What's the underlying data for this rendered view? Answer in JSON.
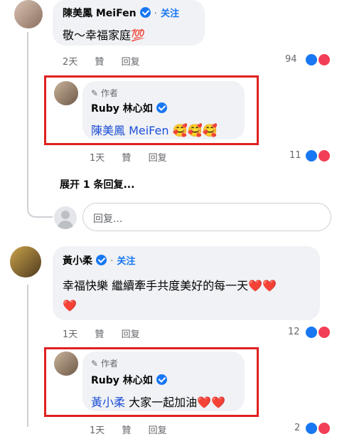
{
  "comments": [
    {
      "author": "陳美鳳 MeiFen",
      "follow": "关注",
      "text": "敬～幸福家庭💯",
      "time": "2天",
      "like": "贊",
      "reply": "回复",
      "count": "94"
    },
    {
      "author": "黃小柔",
      "follow": "关注",
      "text": "幸福快樂 繼續牽手共度美好的每一天❤️❤️",
      "text2": "❤️",
      "time": "1天",
      "like": "贊",
      "reply": "回复",
      "count": "12"
    }
  ],
  "replies": [
    {
      "author_tag": "作者",
      "author": "Ruby 林心如",
      "mention": "陳美鳳 MeiFen",
      "text": "🥰🥰🥰",
      "time": "1天",
      "like": "贊",
      "reply": "回复",
      "count": "11"
    },
    {
      "author_tag": "作者",
      "author": "Ruby 林心如",
      "mention": "黃小柔",
      "text": "大家一起加油❤️❤️",
      "time": "1天",
      "like": "贊",
      "reply": "回复",
      "count": "2"
    }
  ],
  "expand_replies": "展开 1 条回复...",
  "reply_box": {
    "placeholder": "回复..."
  },
  "colors": {
    "accent": "#1877f2",
    "highlight": "#e02020",
    "love": "#f33e58"
  }
}
